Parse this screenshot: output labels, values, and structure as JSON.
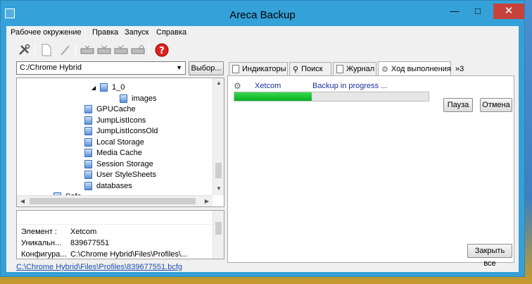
{
  "window": {
    "title": "Areca Backup"
  },
  "menu": {
    "items": [
      "Рабочее окружение",
      "Правка",
      "Запуск",
      "Справка"
    ]
  },
  "toolbar": {
    "icons": [
      "tools-icon",
      "new-document-icon",
      "edit-icon",
      "backup-icon",
      "merge-icon",
      "check-icon",
      "restore-icon",
      "help-icon"
    ]
  },
  "workspace": {
    "path": "C:/Chrome Hybrid",
    "browse_label": "Выбор..."
  },
  "tree": {
    "items": [
      {
        "label": "1_0",
        "level": 2,
        "expander": "◢"
      },
      {
        "label": "images",
        "level": 3,
        "expander": ""
      },
      {
        "label": "GPUCache",
        "level": 1,
        "expander": ""
      },
      {
        "label": "JumpListIcons",
        "level": 1,
        "expander": ""
      },
      {
        "label": "JumpListIconsOld",
        "level": 1,
        "expander": ""
      },
      {
        "label": "Local Storage",
        "level": 1,
        "expander": ""
      },
      {
        "label": "Media Cache",
        "level": 1,
        "expander": ""
      },
      {
        "label": "Session Storage",
        "level": 1,
        "expander": ""
      },
      {
        "label": "User StyleSheets",
        "level": 1,
        "expander": ""
      },
      {
        "label": "databases",
        "level": 1,
        "expander": ""
      },
      {
        "label": "Safe",
        "level": 0,
        "expander": "◢"
      }
    ]
  },
  "info": {
    "rows": [
      {
        "key": "Элемент :",
        "value": "Xetcom"
      },
      {
        "key": "Уникальн...",
        "value": "839677551"
      },
      {
        "key": "Конфигура...",
        "value": "C:\\Chrome Hybrid\\Files\\Profiles\\..."
      }
    ]
  },
  "status": {
    "link": "C:\\Chrome Hybrid\\Files\\Profiles\\839677551.bcfg"
  },
  "tabs": [
    {
      "label": "Индикаторы",
      "icon": "document-icon",
      "active": false
    },
    {
      "label": "Поиск",
      "icon": "search-icon",
      "active": false
    },
    {
      "label": "Журнал",
      "icon": "document-icon",
      "active": false
    },
    {
      "label": "Ход выполнения",
      "icon": "gear-icon",
      "active": true
    },
    {
      "label": "»3",
      "icon": "",
      "active": false
    }
  ],
  "task": {
    "name": "Xetcom",
    "status": "Backup in progress ...",
    "progress_percent": 40,
    "pause_label": "Пауза",
    "cancel_label": "Отмена"
  },
  "footer": {
    "close_all_label": "Закрыть все"
  },
  "colors": {
    "titlebar": "#35a1d9",
    "close": "#c7423a",
    "progress": "#06b025",
    "link": "#1a4fb0"
  }
}
